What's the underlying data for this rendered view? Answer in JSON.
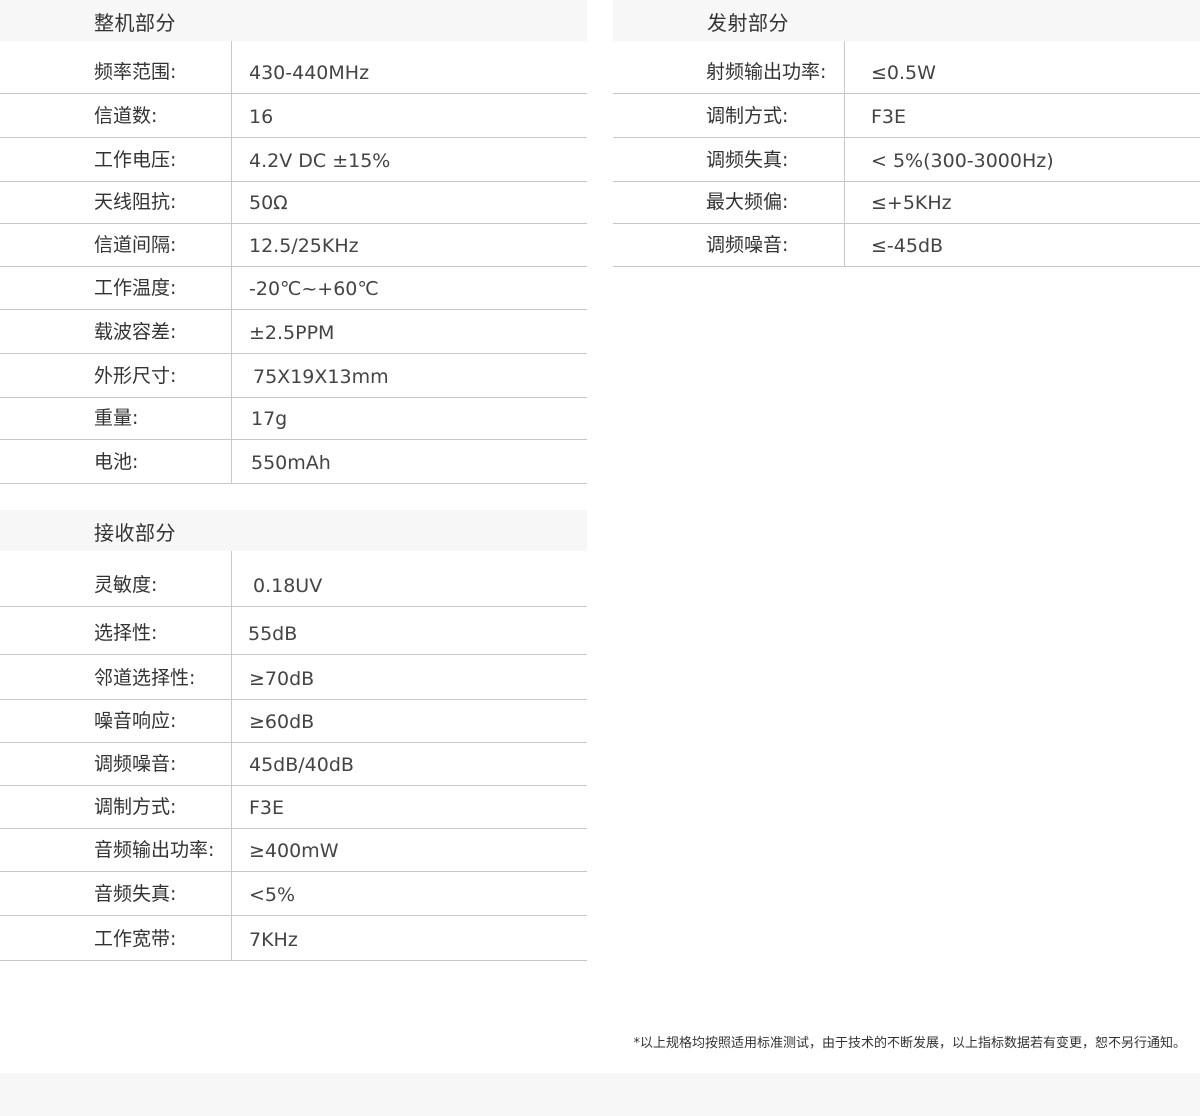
{
  "sections": {
    "whole": {
      "title": "整机部分",
      "rows": [
        {
          "label": "频率范围:",
          "value": "430-440MHz"
        },
        {
          "label": "信道数:",
          "value": "16"
        },
        {
          "label": "工作电压:",
          "value": "4.2V DC ±15%"
        },
        {
          "label": "天线阻抗:",
          "value": "50Ω"
        },
        {
          "label": "信道间隔:",
          "value": "12.5/25KHz"
        },
        {
          "label": "工作温度:",
          "value": "-20℃~+60℃"
        },
        {
          "label": "载波容差:",
          "value": "±2.5PPM"
        },
        {
          "label": "外形尺寸:",
          "value": "75X19X13mm"
        },
        {
          "label": "重量:",
          "value": "17g"
        },
        {
          "label": "电池:",
          "value": "550mAh"
        }
      ]
    },
    "transmit": {
      "title": "发射部分",
      "rows": [
        {
          "label": "射频输出功率:",
          "value": "≤0.5W"
        },
        {
          "label": "调制方式:",
          "value": "F3E"
        },
        {
          "label": "调频失真:",
          "value": "< 5%(300-3000Hz)"
        },
        {
          "label": "最大频偏:",
          "value": "≤+5KHz"
        },
        {
          "label": "调频噪音:",
          "value": "≤-45dB"
        }
      ]
    },
    "receive": {
      "title": "接收部分",
      "rows": [
        {
          "label": "灵敏度:",
          "value": "0.18UV"
        },
        {
          "label": "选择性:",
          "value": "55dB"
        },
        {
          "label": "邻道选择性:",
          "value": "≥70dB"
        },
        {
          "label": "噪音响应:",
          "value": "≥60dB"
        },
        {
          "label": "调频噪音:",
          "value": "45dB/40dB"
        },
        {
          "label": "调制方式:",
          "value": "F3E"
        },
        {
          "label": "音频输出功率:",
          "value": "≥400mW"
        },
        {
          "label": "音频失真:",
          "value": "<5%"
        },
        {
          "label": "工作宽带:",
          "value": "7KHz"
        }
      ]
    }
  },
  "footnote": "*以上规格均按照适用标准测试，由于技术的不断发展，以上指标数据若有变更，恕不另行通知。"
}
